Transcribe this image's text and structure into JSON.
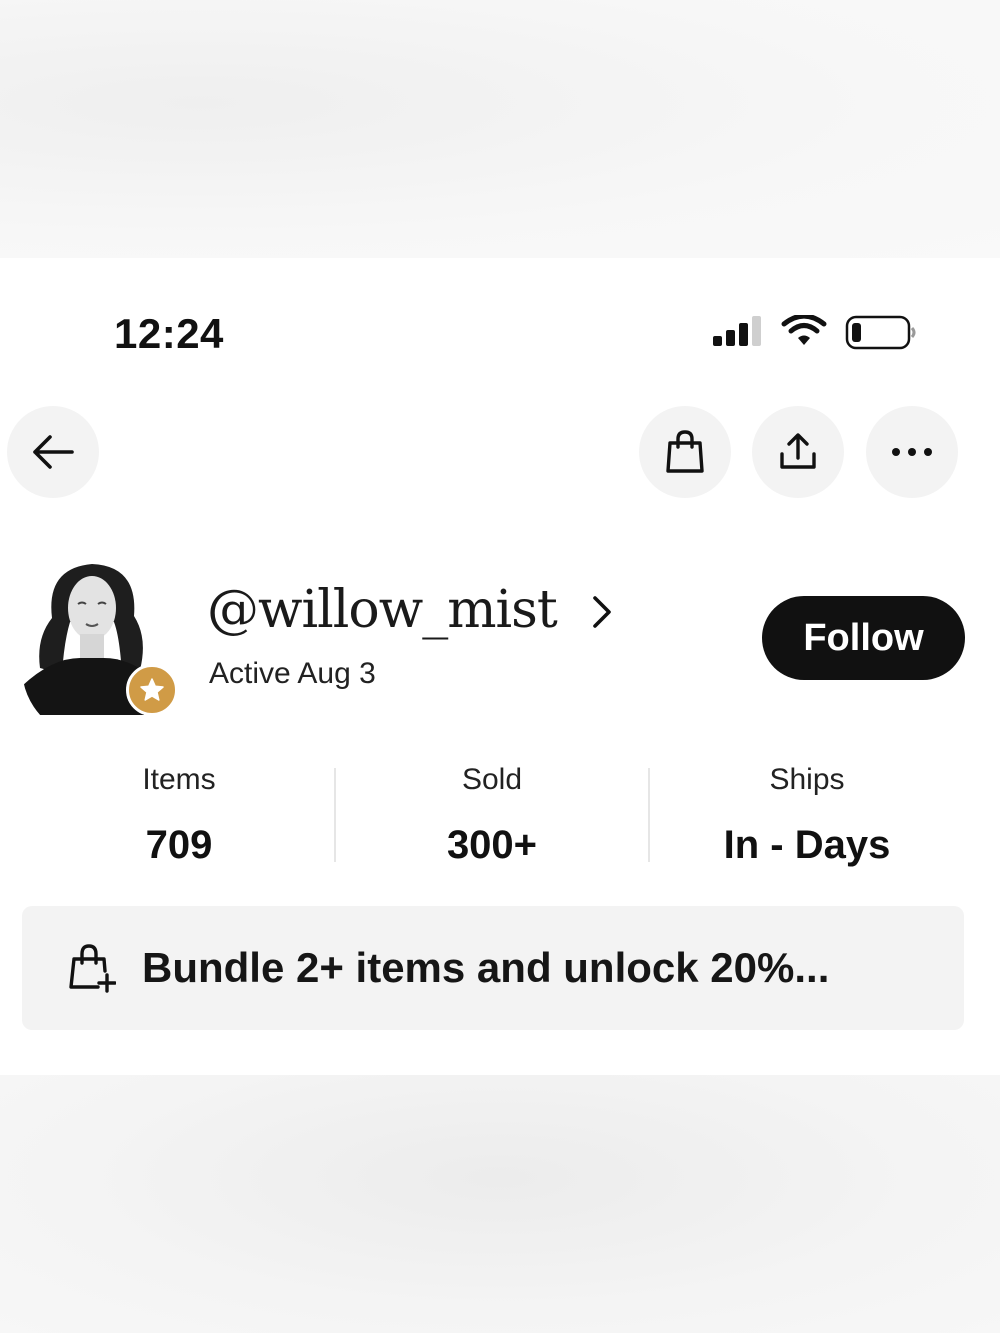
{
  "status_bar": {
    "time": "12:24"
  },
  "nav": {
    "back_icon": "arrow-left-icon",
    "bag_icon": "shopping-bag-icon",
    "share_icon": "share-icon",
    "more_icon": "more-horizontal-icon"
  },
  "profile": {
    "username": "@willow_mist",
    "active": "Active Aug 3",
    "follow_label": "Follow",
    "badge_color": "#d09b46"
  },
  "stats": [
    {
      "label": "Items",
      "value": "709"
    },
    {
      "label": "Sold",
      "value": "300+"
    },
    {
      "label": "Ships",
      "value": "In - Days"
    }
  ],
  "bundle": {
    "text": "Bundle 2+ items and unlock 20%..."
  }
}
